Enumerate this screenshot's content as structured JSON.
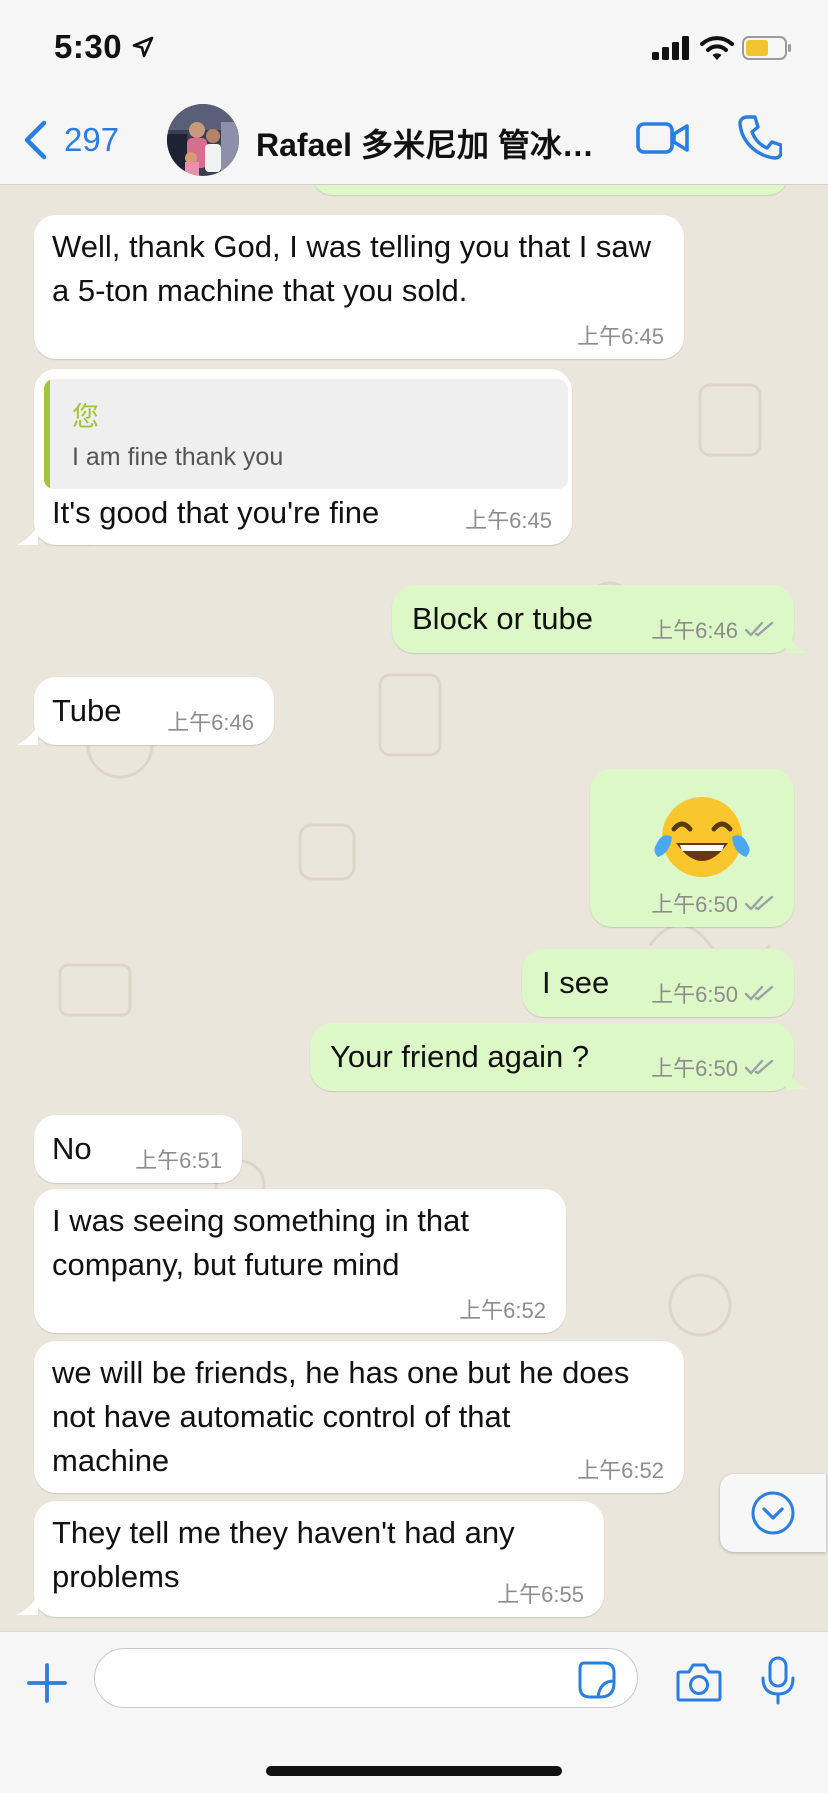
{
  "status_bar": {
    "time": "5:30",
    "icons": [
      "location-arrow-icon",
      "cellular-signal-icon",
      "wifi-icon",
      "battery-low-icon"
    ]
  },
  "header": {
    "back_count": "297",
    "contact_name": "Rafael 多米尼加 管冰…",
    "icons": [
      "chevron-left-icon",
      "avatar",
      "video-call-icon",
      "phone-call-icon"
    ]
  },
  "colors": {
    "accent_blue": "#2a7ee0",
    "outgoing_bubble": "#dcf8c6",
    "incoming_bubble": "#ffffff",
    "quote_green": "#a2c43a",
    "chat_background": "#ebe6dc"
  },
  "messages": [
    {
      "direction": "in",
      "text": "Well, thank God, I was telling you that I saw a 5-ton machine that you sold.",
      "time": "上午6:45"
    },
    {
      "direction": "in",
      "quote_author": "您",
      "quote_text": "I am fine thank you",
      "text": "It's good that you're fine",
      "time": "上午6:45"
    },
    {
      "direction": "out",
      "text": "Block or tube",
      "time": "上午6:46",
      "status": "read"
    },
    {
      "direction": "in",
      "text": "Tube",
      "time": "上午6:46"
    },
    {
      "direction": "out",
      "emoji": "face-with-tears-of-joy",
      "time": "上午6:50",
      "status": "read"
    },
    {
      "direction": "out",
      "text": "I see",
      "time": "上午6:50",
      "status": "read"
    },
    {
      "direction": "out",
      "text": "Your friend again ?",
      "time": "上午6:50",
      "status": "read"
    },
    {
      "direction": "in",
      "text": "No",
      "time": "上午6:51"
    },
    {
      "direction": "in",
      "text": "I was seeing something in that company, but future mind",
      "time": "上午6:52"
    },
    {
      "direction": "in",
      "text": "we will be friends, he has one but he does not have automatic control of that machine",
      "time": "上午6:52"
    },
    {
      "direction": "in",
      "text": "They tell me they haven't had any problems",
      "time": "上午6:55"
    }
  ],
  "composer": {
    "input_value": "",
    "icons": [
      "plus-icon",
      "sticker-icon",
      "camera-icon",
      "microphone-icon"
    ]
  }
}
